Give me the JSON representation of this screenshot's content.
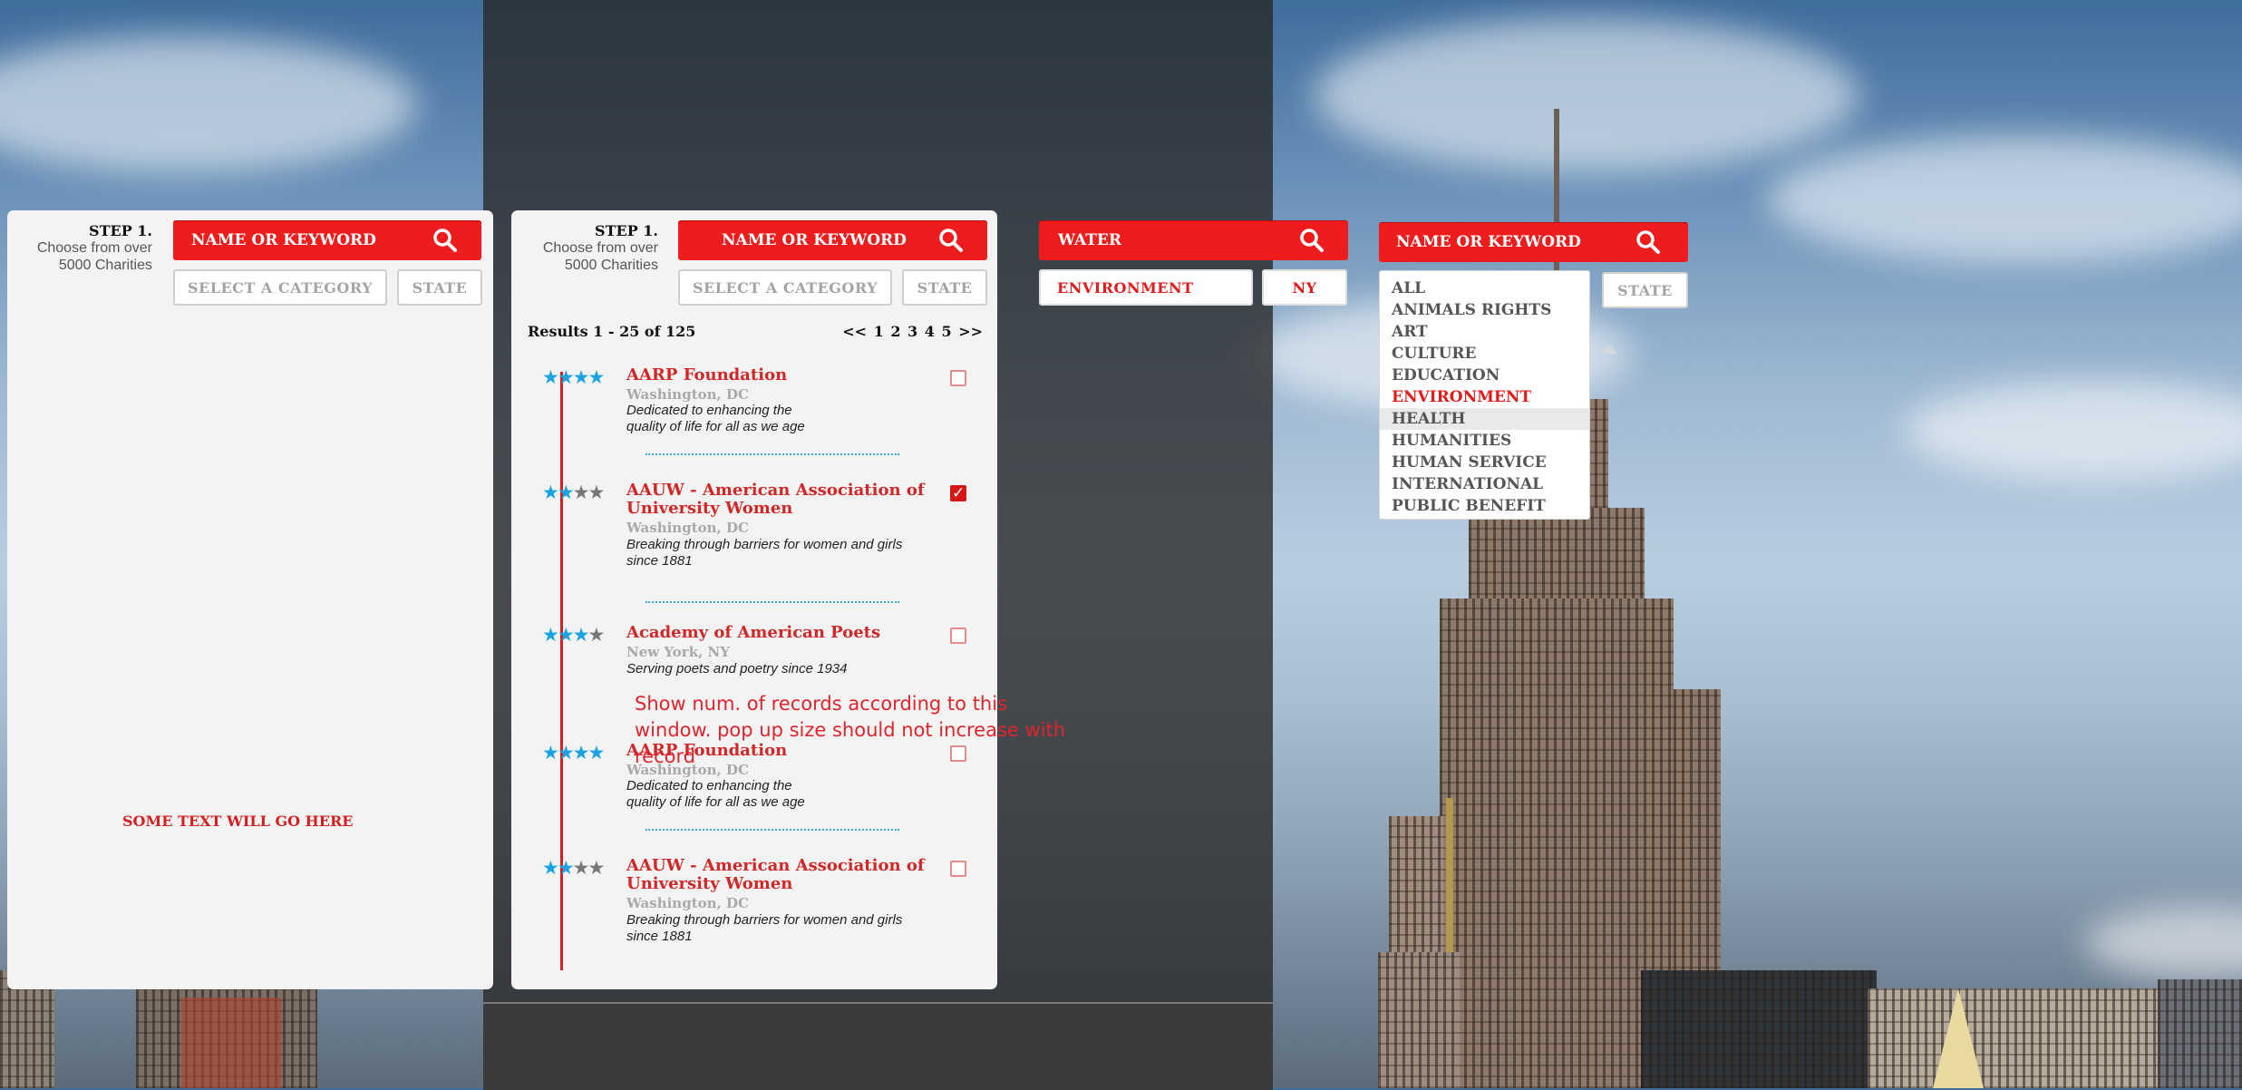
{
  "step": {
    "title": "STEP 1.",
    "line1": "Choose from over",
    "line2": "5000 Charities"
  },
  "search": {
    "placeholder": "NAME OR KEYWORD",
    "filled_value": "WATER"
  },
  "filters": {
    "category_placeholder": "SELECT A CATEGORY",
    "state_placeholder": "STATE",
    "category_selected": "ENVIRONMENT",
    "state_selected": "NY"
  },
  "panel1": {
    "placeholder_text": "SOME TEXT WILL GO HERE"
  },
  "results": {
    "summary": "Results 1 - 25 of 125",
    "pager": {
      "prev": "<<",
      "pages": [
        "1",
        "2",
        "3",
        "4",
        "5"
      ],
      "next": ">>"
    },
    "items": [
      {
        "name": "AARP Foundation",
        "location": "Washington, DC",
        "description": "Dedicated to enhancing the quality of life for all as we age",
        "rating": 4,
        "checked": false
      },
      {
        "name": "AAUW - American Association of University Women",
        "location": "Washington, DC",
        "description": "Breaking through barriers for women and girls since 1881",
        "rating": 2,
        "checked": true
      },
      {
        "name": "Academy of American Poets",
        "location": "New York, NY",
        "description": "Serving poets and poetry since 1934",
        "rating": 3,
        "checked": false
      },
      {
        "name": "AARP Foundation",
        "location": "Washington, DC",
        "description": "Dedicated to enhancing the quality of life for all as we age",
        "rating": 4,
        "checked": false
      },
      {
        "name": "AAUW - American Association of University Women",
        "location": "Washington, DC",
        "description": "Breaking through barriers for women and girls since 1881",
        "rating": 2,
        "checked": false
      }
    ],
    "check_mark": "✓"
  },
  "annotation": "Show num. of records according to this window. pop up size should not increase with record",
  "categories": {
    "options": [
      "ALL",
      "ANIMALS RIGHTS",
      "ART",
      "CULTURE",
      "EDUCATION",
      "ENVIRONMENT",
      "HEALTH",
      "HUMANITIES",
      "HUMAN SERVICE",
      "INTERNATIONAL",
      "PUBLIC BENEFIT"
    ],
    "selected": "ENVIRONMENT",
    "hovered": "HEALTH"
  },
  "colors": {
    "accent_red": "#ee1c1c",
    "star_blue": "#1aa3e0",
    "star_gray": "#777777",
    "separator_blue": "#3aa9d9"
  },
  "icons": {
    "search": "search-icon",
    "star": "star-icon",
    "checkbox": "checkbox-icon"
  }
}
